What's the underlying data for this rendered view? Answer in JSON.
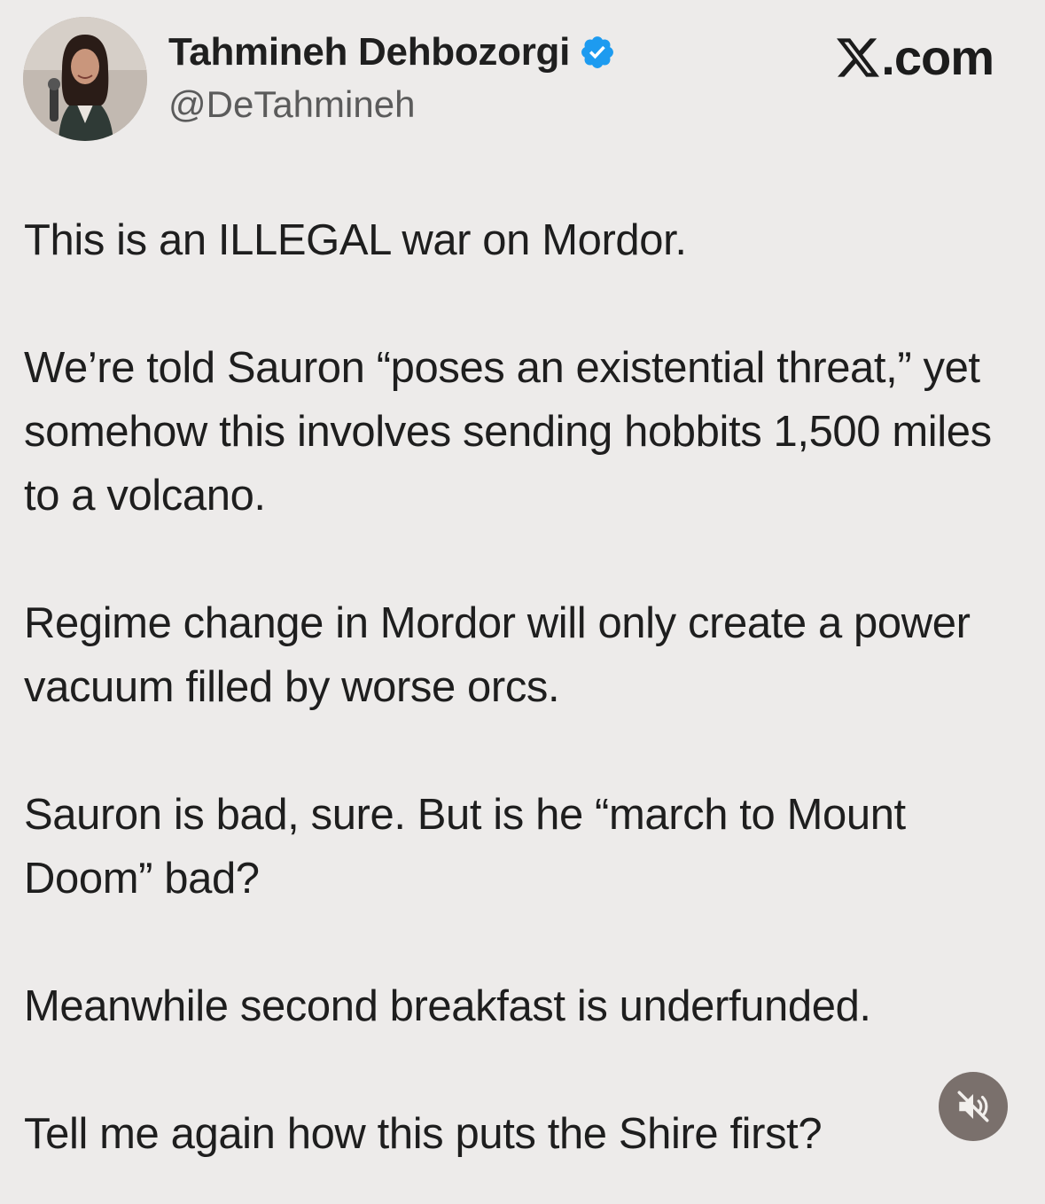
{
  "header": {
    "display_name": "Tahmineh Dehbozorgi",
    "handle": "@DeTahmineh",
    "brand_text": ".com",
    "verified_color": "#1d9bf0"
  },
  "avatar": {
    "icon": "profile-photo"
  },
  "tweet": {
    "paragraphs": [
      "This is an ILLEGAL war on Mordor.",
      "We’re told Sauron “poses an existential threat,” yet somehow this involves sending hobbits 1,500 miles to a volcano.",
      "Regime change in Mordor will only create a power vacuum filled by worse orcs.",
      "Sauron is bad, sure. But is he “march to Mount Doom” bad?",
      "Meanwhile second breakfast is underfunded.",
      "Tell me again how this puts the Shire first?"
    ]
  },
  "controls": {
    "mute_icon": "speaker-muted-icon",
    "mute_bg": "#7a706c"
  }
}
